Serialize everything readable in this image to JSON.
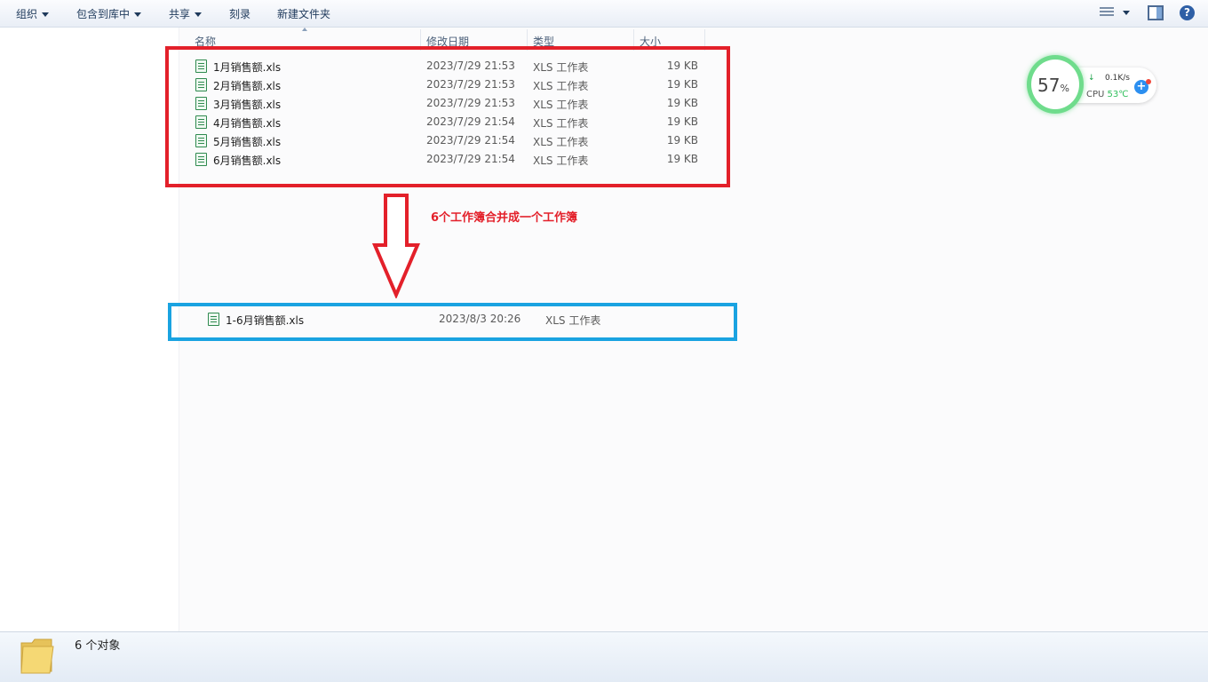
{
  "toolbar": {
    "organize": "组织",
    "include_in_library": "包含到库中",
    "share": "共享",
    "burn": "刻录",
    "new_folder": "新建文件夹",
    "help": "?"
  },
  "columns": {
    "name": "名称",
    "date_modified": "修改日期",
    "type": "类型",
    "size": "大小"
  },
  "files": [
    {
      "name": "1月销售额.xls",
      "date": "2023/7/29 21:53",
      "type": "XLS 工作表",
      "size": "19 KB"
    },
    {
      "name": "2月销售额.xls",
      "date": "2023/7/29 21:53",
      "type": "XLS 工作表",
      "size": "19 KB"
    },
    {
      "name": "3月销售额.xls",
      "date": "2023/7/29 21:53",
      "type": "XLS 工作表",
      "size": "19 KB"
    },
    {
      "name": "4月销售额.xls",
      "date": "2023/7/29 21:54",
      "type": "XLS 工作表",
      "size": "19 KB"
    },
    {
      "name": "5月销售额.xls",
      "date": "2023/7/29 21:54",
      "type": "XLS 工作表",
      "size": "19 KB"
    },
    {
      "name": "6月销售额.xls",
      "date": "2023/7/29 21:54",
      "type": "XLS 工作表",
      "size": "19 KB"
    }
  ],
  "annotation": {
    "text": "6个工作簿合并成一个工作簿",
    "box_colors": {
      "source": "#e3202a",
      "result": "#1aa3e1"
    }
  },
  "merged_file": {
    "name": "1-6月销售额.xls",
    "date": "2023/8/3 20:26",
    "type": "XLS 工作表"
  },
  "widget": {
    "percent": "57",
    "percent_sign": "%",
    "net_speed": "0.1K/s",
    "cpu_label": "CPU",
    "cpu_temp": "53℃",
    "plus": "+"
  },
  "status": {
    "object_count": "6 个对象"
  },
  "icons": {
    "file": "excel-file-icon",
    "folder": "folder-icon",
    "view": "view-options-icon",
    "preview": "preview-pane-icon",
    "help": "help-icon"
  }
}
